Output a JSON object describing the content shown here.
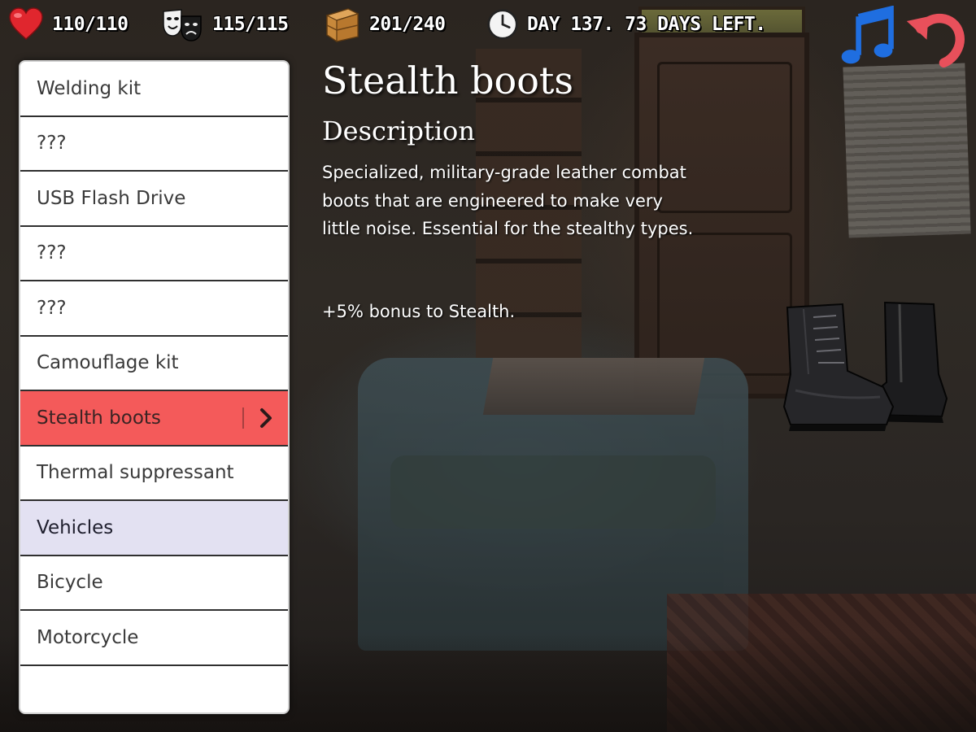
{
  "hud": {
    "health": "110/110",
    "mood": "115/115",
    "storage": "201/240",
    "day": "DAY 137. 73 DAYS LEFT.",
    "icons": [
      "heart-icon",
      "theater-masks-icon",
      "wooden-crate-icon",
      "clock-icon"
    ]
  },
  "controls": {
    "music_icon": "music-note-icon",
    "back_icon": "undo-arrow-icon"
  },
  "items": [
    {
      "label": "Welding kit",
      "type": "item"
    },
    {
      "label": "???",
      "type": "item"
    },
    {
      "label": "USB Flash Drive",
      "type": "item"
    },
    {
      "label": "???",
      "type": "item"
    },
    {
      "label": "???",
      "type": "item"
    },
    {
      "label": "Camouflage kit",
      "type": "item"
    },
    {
      "label": "Stealth boots",
      "type": "selected"
    },
    {
      "label": "Thermal suppressant",
      "type": "item"
    },
    {
      "label": "Vehicles",
      "type": "category"
    },
    {
      "label": "Bicycle",
      "type": "item"
    },
    {
      "label": "Motorcycle",
      "type": "item"
    }
  ],
  "detail": {
    "title": "Stealth boots",
    "subtitle": "Description",
    "description": "Specialized, military-grade leather combat boots that are engineered to make very little noise.  Essential for the stealthy types.",
    "bonus": "+5% bonus to Stealth.",
    "image_icon": "stealth-boots-icon"
  },
  "colors": {
    "selected_row": "#f45a5a",
    "category_row": "#e3e1f2",
    "music_icon": "#1f6ee0",
    "back_icon": "#e8505b",
    "heart_icon": "#e0262e"
  }
}
